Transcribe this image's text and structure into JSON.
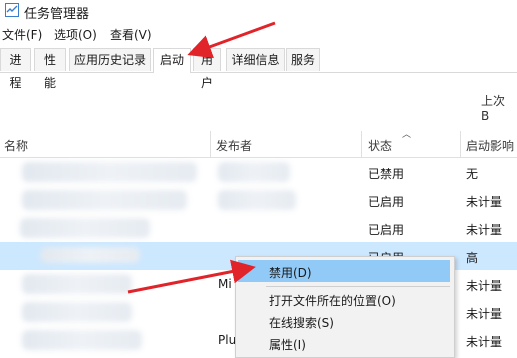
{
  "window": {
    "title": "任务管理器"
  },
  "menu": [
    "文件(F)",
    "选项(O)",
    "查看(V)"
  ],
  "tabs": [
    "进程",
    "性能",
    "应用历史记录",
    "启动",
    "用户",
    "详细信息",
    "服务"
  ],
  "active_tab": "启动",
  "bios_label": "上次 B",
  "columns": {
    "name": "名称",
    "publisher": "发布者",
    "status": "状态",
    "impact": "启动影响"
  },
  "rows": [
    {
      "name": "",
      "publisher": "",
      "status": "已禁用",
      "impact": "无"
    },
    {
      "name": "",
      "publisher": "",
      "status": "已启用",
      "impact": "未计量"
    },
    {
      "name": "",
      "publisher": "",
      "status": "已启用",
      "impact": "未计量"
    },
    {
      "name": "",
      "publisher": "",
      "status": "已启用",
      "impact": "高"
    },
    {
      "name": "",
      "publisher": "Mi",
      "status": "",
      "impact": "未计量"
    },
    {
      "name": "",
      "publisher": "",
      "status": "",
      "impact": "未计量"
    },
    {
      "name": "",
      "publisher": "Plu",
      "status": "",
      "impact": "未计量"
    }
  ],
  "context_menu": {
    "items": [
      "禁用(D)",
      "打开文件所在的位置(O)",
      "在线搜索(S)",
      "属性(I)"
    ],
    "highlighted": "禁用(D)"
  },
  "colors": {
    "selection": "#cce8ff",
    "menu_highlight": "#91c9f7",
    "annotation_arrow": "#e0242a"
  }
}
